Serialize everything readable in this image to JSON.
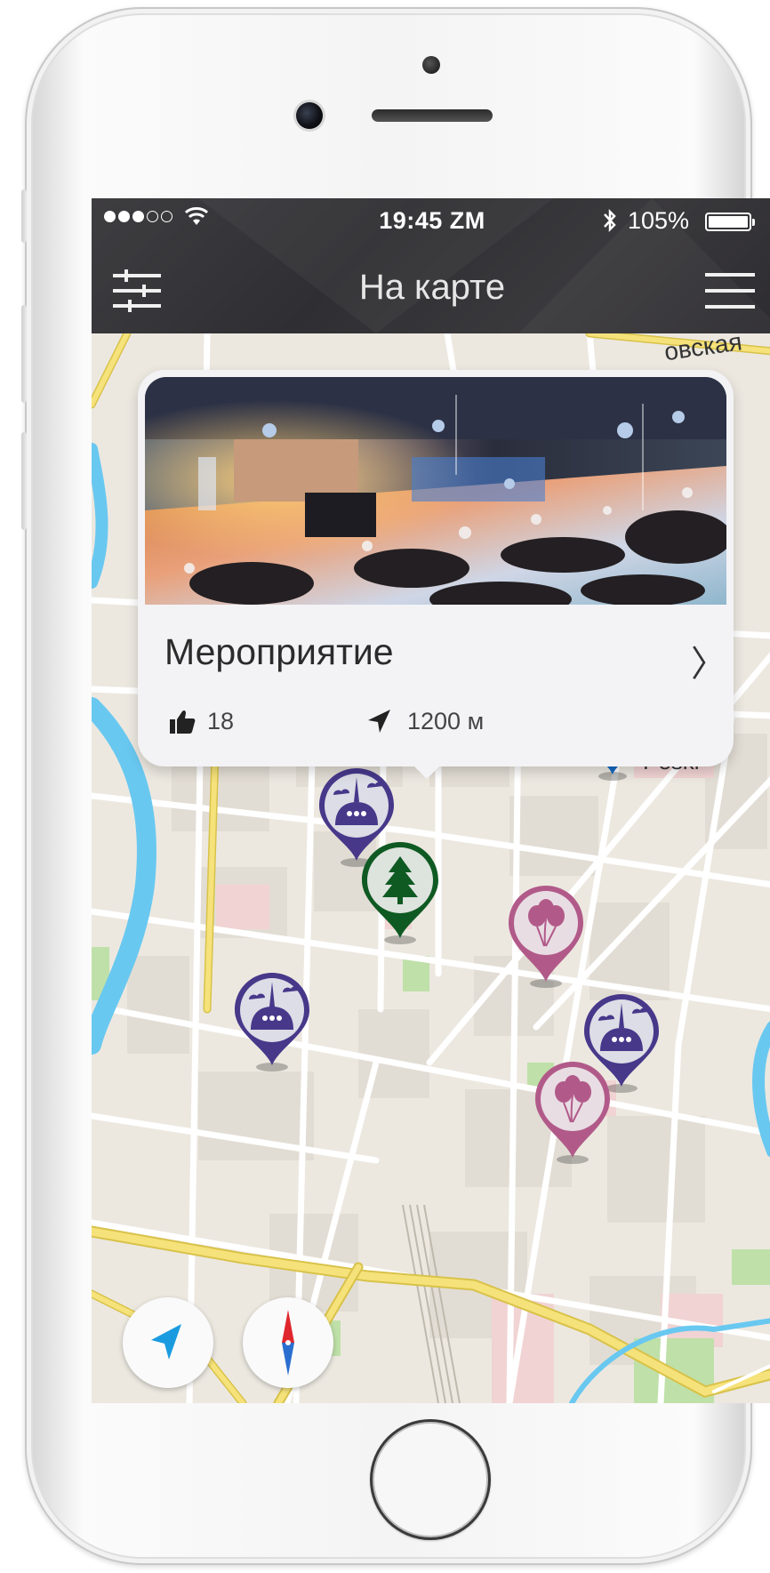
{
  "status_bar": {
    "time": "19:45 ZM",
    "battery": "105%",
    "signal_strength": 3,
    "signal_max": 5
  },
  "nav": {
    "title": "На карте",
    "filter_icon": "sliders-icon",
    "menu_icon": "hamburger-icon"
  },
  "popup": {
    "title": "Мероприятие",
    "likes": "18",
    "distance": "1200 м",
    "chevron": "〉"
  },
  "map": {
    "district_label": "Peski",
    "street_label": "овская",
    "pins": [
      {
        "type": "city",
        "color": "#47388a"
      },
      {
        "type": "city",
        "color": "#47388a"
      },
      {
        "type": "city",
        "color": "#47388a"
      },
      {
        "type": "city",
        "color": "#1468c2"
      },
      {
        "type": "park",
        "color": "#0f5a23"
      },
      {
        "type": "party",
        "color": "#b15a89"
      },
      {
        "type": "party",
        "color": "#b15a89"
      }
    ]
  },
  "controls": {
    "locate_icon": "location-arrow-icon",
    "compass_icon": "compass-icon"
  },
  "colors": {
    "top_bar": "#333236",
    "city_pin": "#47388a",
    "park_pin": "#0f5a23",
    "party_pin": "#b15a89",
    "blue_pin": "#1468c2",
    "locate_accent": "#1a9be0",
    "road_yellow": "#f3dd5a",
    "water": "#69c8f0"
  }
}
